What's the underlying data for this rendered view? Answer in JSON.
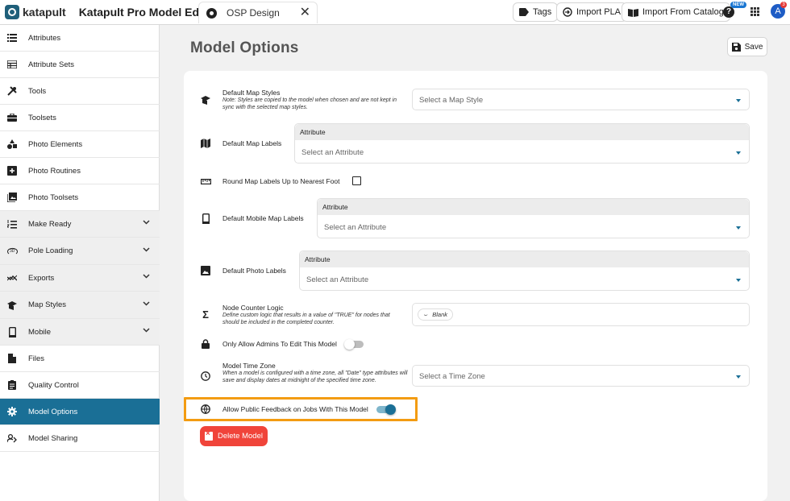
{
  "brand": {
    "name": "katapult",
    "app_title": "Katapult Pro Model Editor"
  },
  "project_tab": {
    "label": "OSP Design"
  },
  "toolbar": {
    "tags_label": "Tags",
    "import_pla_label": "Import PLA",
    "import_catalog_label": "Import From Catalog",
    "help_badge": "NEW",
    "avatar_initial": "A",
    "notification_count": "3"
  },
  "sidebar": {
    "items": [
      {
        "label": "Attributes",
        "icon": "list-icon"
      },
      {
        "label": "Attribute Sets",
        "icon": "table-icon"
      },
      {
        "label": "Tools",
        "icon": "tools-icon"
      },
      {
        "label": "Toolsets",
        "icon": "toolbox-icon"
      },
      {
        "label": "Photo Elements",
        "icon": "shapes-icon"
      },
      {
        "label": "Photo Routines",
        "icon": "add-box-icon"
      },
      {
        "label": "Photo Toolsets",
        "icon": "photo-library-icon"
      },
      {
        "label": "Make Ready",
        "icon": "list-numbered-icon"
      },
      {
        "label": "Pole Loading",
        "icon": "3d-icon"
      },
      {
        "label": "Exports",
        "icon": "trending-icon"
      },
      {
        "label": "Map Styles",
        "icon": "map-style-icon"
      },
      {
        "label": "Mobile",
        "icon": "phone-icon"
      },
      {
        "label": "Files",
        "icon": "file-icon"
      },
      {
        "label": "Quality Control",
        "icon": "clipboard-icon"
      },
      {
        "label": "Model Options",
        "icon": "gear-icon"
      },
      {
        "label": "Model Sharing",
        "icon": "share-icon"
      }
    ]
  },
  "page": {
    "title": "Model Options",
    "save_label": "Save"
  },
  "options": {
    "map_styles": {
      "label": "Default Map Styles",
      "note": "Note: Styles are copied to the model when chosen and are not kept in sync with the selected map styles.",
      "placeholder": "Select a Map Style"
    },
    "map_labels": {
      "label": "Default Map Labels",
      "header": "Attribute",
      "placeholder": "Select an Attribute"
    },
    "round_labels": {
      "label": "Round Map Labels Up to Nearest Foot",
      "checked": false
    },
    "mobile_labels": {
      "label": "Default Mobile Map Labels",
      "header": "Attribute",
      "placeholder": "Select an Attribute"
    },
    "photo_labels": {
      "label": "Default Photo Labels",
      "header": "Attribute",
      "placeholder": "Select an Attribute"
    },
    "node_counter": {
      "label": "Node Counter Logic",
      "note": "Define custom logic that results in a value of \"TRUE\" for nodes that should be included in the completed counter.",
      "chip": "Blank"
    },
    "admins_only": {
      "label": "Only Allow Admins To Edit This Model",
      "enabled": false
    },
    "time_zone": {
      "label": "Model Time Zone",
      "note": "When a model is configured with a time zone, all \"Date\" type attributes will save and display dates at midnight of the specified time zone.",
      "placeholder": "Select a Time Zone"
    },
    "public_feedback": {
      "label": "Allow Public Feedback on Jobs With This Model",
      "enabled": true
    }
  },
  "delete_label": "Delete Model",
  "colors": {
    "accent": "#1a6f96",
    "danger": "#f0443a",
    "highlight": "#f39c12"
  }
}
